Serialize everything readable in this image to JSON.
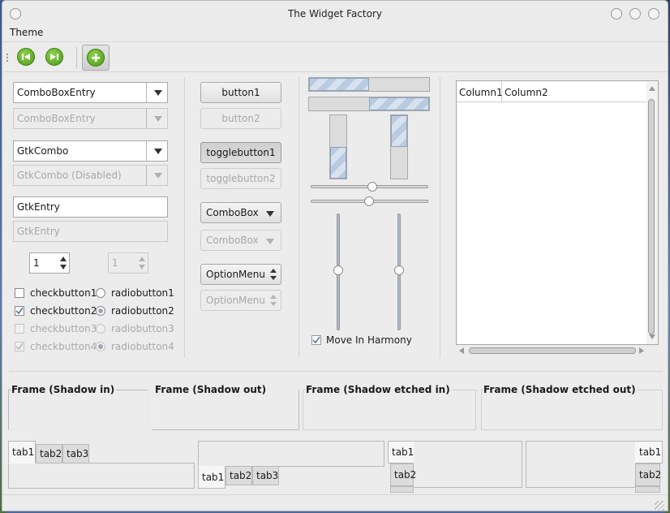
{
  "window": {
    "title": "The Widget Factory"
  },
  "menubar": {
    "items": [
      "Theme"
    ]
  },
  "toolbar": {
    "icons": [
      "go-first-icon",
      "go-last-icon",
      "add-icon"
    ]
  },
  "col1": {
    "comboentry": {
      "value": "ComboBoxEntry"
    },
    "comboentry_dis": {
      "value": "ComboBoxEntry"
    },
    "gtkcombo": {
      "value": "GtkCombo"
    },
    "gtkcombo_dis": {
      "value": "GtkCombo (Disabled)"
    },
    "entry": {
      "value": "GtkEntry"
    },
    "entry_dis": {
      "value": "GtkEntry"
    },
    "spin": {
      "value": "1"
    },
    "spin_dis": {
      "value": "1"
    },
    "checks": [
      {
        "label": "checkbutton1",
        "checked": false,
        "disabled": false
      },
      {
        "label": "checkbutton2",
        "checked": true,
        "disabled": false
      },
      {
        "label": "checkbutton3",
        "checked": false,
        "disabled": true
      },
      {
        "label": "checkbutton4",
        "checked": true,
        "disabled": true
      }
    ],
    "radios": [
      {
        "label": "radiobutton1",
        "selected": false,
        "disabled": false
      },
      {
        "label": "radiobutton2",
        "selected": true,
        "disabled": false
      },
      {
        "label": "radiobutton3",
        "selected": false,
        "disabled": true
      },
      {
        "label": "radiobutton4",
        "selected": true,
        "disabled": true
      }
    ]
  },
  "col2": {
    "button1": "button1",
    "button2": "button2",
    "toggle1": "togglebutton1",
    "toggle2": "togglebutton2",
    "combobox": "ComboBox",
    "combobox_dis": "ComboBox",
    "optionmenu": "OptionMenu",
    "optionmenu_dis": "OptionMenu"
  },
  "col3": {
    "progress_h1": 0.5,
    "progress_h2": 0.5,
    "progress_v1": 0.5,
    "progress_v2": 0.5,
    "harmony_label": "Move In Harmony",
    "harmony_checked": true
  },
  "tree": {
    "columns": [
      "Column1",
      "Column2"
    ]
  },
  "frames": [
    "Frame (Shadow in)",
    "Frame (Shadow out)",
    "Frame (Shadow etched in)",
    "Frame (Shadow etched out)"
  ],
  "tabs": [
    "tab1",
    "tab2",
    "tab3"
  ]
}
